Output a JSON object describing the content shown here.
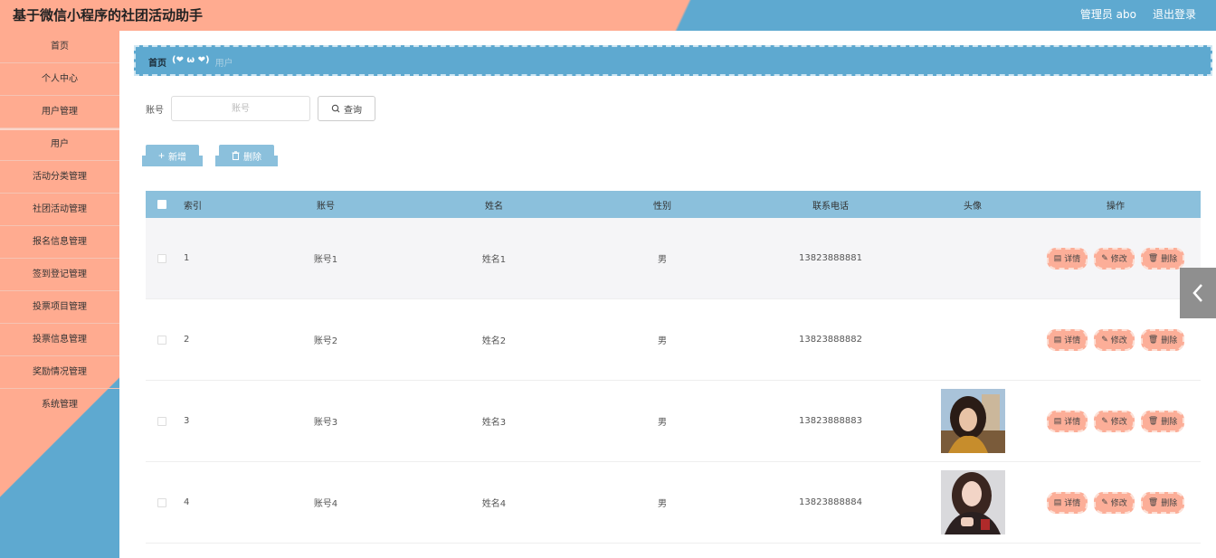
{
  "header": {
    "title": "基于微信小程序的社团活动助手",
    "user": "管理员 abo",
    "logout": "退出登录"
  },
  "sidebar": {
    "items": [
      {
        "label": "首页"
      },
      {
        "label": "个人中心"
      },
      {
        "label": "用户管理"
      },
      {
        "label": "用户"
      },
      {
        "label": "活动分类管理"
      },
      {
        "label": "社团活动管理"
      },
      {
        "label": "报名信息管理"
      },
      {
        "label": "签到登记管理"
      },
      {
        "label": "投票项目管理"
      },
      {
        "label": "投票信息管理"
      },
      {
        "label": "奖励情况管理"
      },
      {
        "label": "系统管理"
      }
    ]
  },
  "breadcrumb": {
    "home": "首页",
    "separator": "(❤ ω ❤)",
    "current": "用户"
  },
  "search": {
    "label": "账号",
    "placeholder": "账号",
    "button": "查询"
  },
  "actions": {
    "add": "新增",
    "delete": "删除"
  },
  "table": {
    "columns": [
      "索引",
      "账号",
      "姓名",
      "性别",
      "联系电话",
      "头像",
      "操作"
    ],
    "rows": [
      {
        "index": "1",
        "account": "账号1",
        "name": "姓名1",
        "gender": "男",
        "phone": "13823888881",
        "avatar": "none"
      },
      {
        "index": "2",
        "account": "账号2",
        "name": "姓名2",
        "gender": "男",
        "phone": "13823888882",
        "avatar": "none"
      },
      {
        "index": "3",
        "account": "账号3",
        "name": "姓名3",
        "gender": "男",
        "phone": "13823888883",
        "avatar": "photo-woman-outdoor"
      },
      {
        "index": "4",
        "account": "账号4",
        "name": "姓名4",
        "gender": "男",
        "phone": "13823888884",
        "avatar": "photo-woman-portrait"
      }
    ],
    "row_ops": {
      "detail": "详情",
      "edit": "修改",
      "delete": "删除"
    }
  },
  "colors": {
    "salmon": "#ffab90",
    "blue": "#5ea9d0",
    "light_blue": "#8bc0dc",
    "op_pink": "#fcae98"
  }
}
